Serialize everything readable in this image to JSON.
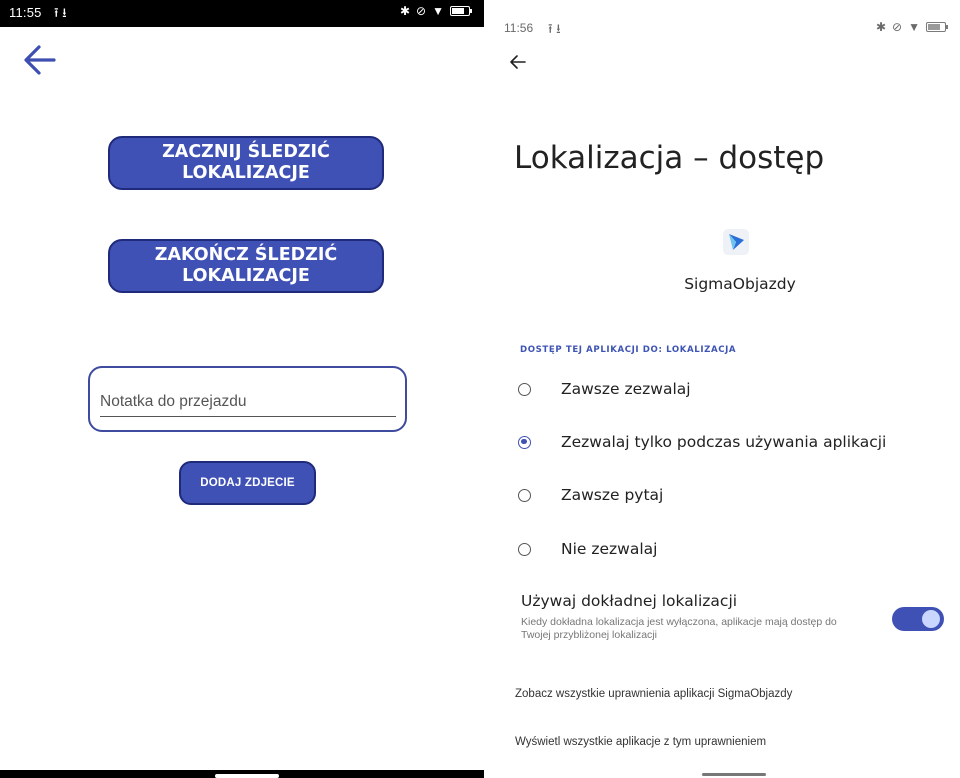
{
  "left": {
    "status": {
      "time": "11:55",
      "transfer_icons": "⭱ ⭳"
    },
    "buttons": {
      "start": "ZACZNIJ ŚLEDZIĆ\nLOKALIZACJE",
      "stop": "ZAKOŃCZ ŚLEDZIĆ\nLOKALIZACJE",
      "photo": "DODAJ ZDJECIE"
    },
    "note": {
      "placeholder": "Notatka do przejazdu",
      "value": ""
    },
    "accent_color": "#3f51b5"
  },
  "right": {
    "status": {
      "time": "11:56",
      "transfer_icons": "⭱ ⭳"
    },
    "title": "Lokalizacja – dostęp",
    "app_name": "SigmaObjazdy",
    "section_header": "DOSTĘP TEJ APLIKACJI DO: LOKALIZACJA",
    "options": [
      {
        "label": "Zawsze zezwalaj",
        "selected": false
      },
      {
        "label": "Zezwalaj tylko podczas używania aplikacji",
        "selected": true
      },
      {
        "label": "Zawsze pytaj",
        "selected": false
      },
      {
        "label": "Nie zezwalaj",
        "selected": false
      }
    ],
    "precise": {
      "title": "Używaj dokładnej lokalizacji",
      "description": "Kiedy dokładna lokalizacja jest wyłączona, aplikacje mają dostęp do Twojej przybliżonej lokalizacji",
      "enabled": true
    },
    "links": {
      "all_permissions": "Zobacz wszystkie uprawnienia aplikacji SigmaObjazdy",
      "all_apps": "Wyświetl wszystkie aplikacje z tym uprawnieniem"
    },
    "status_icons": [
      "bluetooth-icon",
      "no-sound-icon",
      "wifi-icon",
      "battery-icon"
    ]
  }
}
